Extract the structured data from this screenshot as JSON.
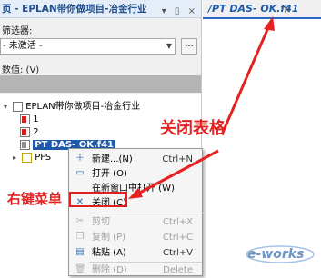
{
  "left_panel": {
    "title": "页 - EPLAN带你做项目-冶金行业",
    "title_icons": "▾ ▯ ×",
    "filter_label": "筛选器:",
    "filter_value": "- 未激活 -",
    "filter_button": "...",
    "value_label": "数值: (V)",
    "tree": [
      {
        "label": "EPLAN带你做项目-冶金行业",
        "toggle": "▾"
      },
      {
        "label": "1",
        "toggle": ""
      },
      {
        "label": "2",
        "toggle": ""
      },
      {
        "label": "PT DAS- OK.f41",
        "toggle": ""
      },
      {
        "label": "PFS",
        "toggle": "▸"
      }
    ]
  },
  "tab": {
    "label": "/PT DAS- OK.f41",
    "close": "×"
  },
  "menu": {
    "items": [
      {
        "label": "新建...(N)",
        "shortcut": "Ctrl+N",
        "icon": "＋"
      },
      {
        "label": "打开 (O)",
        "shortcut": "",
        "icon": "▭"
      },
      {
        "label": "在新窗口中打开 (W)",
        "shortcut": "",
        "icon": ""
      },
      {
        "label": "关闭 (C)",
        "shortcut": "",
        "icon": "✕"
      },
      {
        "label": "剪切",
        "shortcut": "Ctrl+X",
        "icon": "✂"
      },
      {
        "label": "复制 (P)",
        "shortcut": "Ctrl+C",
        "icon": "❐"
      },
      {
        "label": "粘贴 (A)",
        "shortcut": "Ctrl+V",
        "icon": "▤"
      },
      {
        "label": "删除 (D)",
        "shortcut": "Delete",
        "icon": "🗑"
      }
    ]
  },
  "annotations": {
    "close_table": "关闭表格",
    "right_menu": "右键菜单"
  },
  "watermark": "e-works",
  "colors": {
    "annotation_red": "#e52222",
    "selection_blue": "#1f5aa8",
    "tab_accent": "#2a66c8"
  }
}
